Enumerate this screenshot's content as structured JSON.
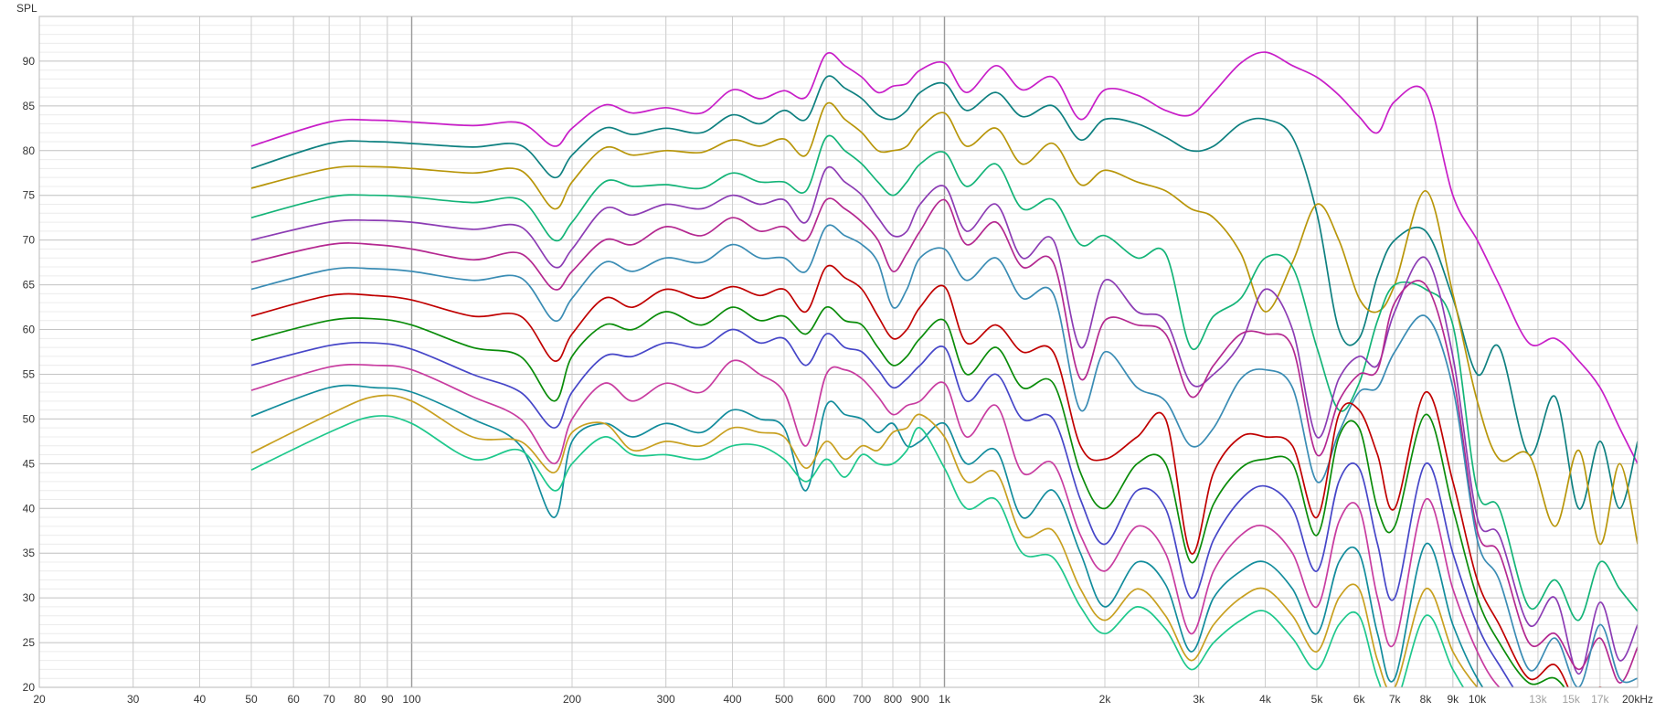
{
  "chart_data": {
    "type": "line",
    "ylabel": "SPL",
    "xscale": "log",
    "xlim": [
      20,
      20000
    ],
    "ylim": [
      20,
      95
    ],
    "grid": true,
    "x_tick_values": [
      20,
      30,
      40,
      50,
      60,
      70,
      80,
      90,
      100,
      200,
      300,
      400,
      500,
      600,
      700,
      800,
      900,
      1000,
      2000,
      3000,
      4000,
      5000,
      6000,
      7000,
      8000,
      9000,
      10000,
      13000,
      15000,
      17000,
      20000
    ],
    "x_tick_labels": [
      "20",
      "30",
      "40",
      "50",
      "60",
      "70",
      "80",
      "90",
      "100",
      "200",
      "300",
      "400",
      "500",
      "600",
      "700",
      "800",
      "900",
      "1k",
      "2k",
      "3k",
      "4k",
      "5k",
      "6k",
      "7k",
      "8k",
      "9k",
      "10k",
      "13k",
      "15k",
      "17k",
      "20kHz"
    ],
    "x_tick_faint": [
      false,
      false,
      false,
      false,
      false,
      false,
      false,
      false,
      false,
      false,
      false,
      false,
      false,
      false,
      false,
      false,
      false,
      false,
      false,
      false,
      false,
      false,
      false,
      false,
      false,
      false,
      false,
      true,
      true,
      true,
      false
    ],
    "y_tick_values": [
      20,
      25,
      30,
      35,
      40,
      45,
      50,
      55,
      60,
      65,
      70,
      75,
      80,
      85,
      90
    ],
    "y_tick_labels": [
      "20",
      "25",
      "30",
      "35",
      "40",
      "45",
      "50",
      "55",
      "60",
      "65",
      "70",
      "75",
      "80",
      "85",
      "90"
    ],
    "freqs": [
      50,
      70,
      85,
      100,
      130,
      160,
      185,
      200,
      230,
      260,
      300,
      350,
      400,
      450,
      500,
      550,
      600,
      650,
      700,
      750,
      800,
      850,
      900,
      1000,
      1100,
      1250,
      1400,
      1600,
      1800,
      2000,
      2300,
      2600,
      2900,
      3200,
      3600,
      4000,
      4500,
      5000,
      5500,
      6000,
      6500,
      7000,
      8000,
      9000,
      10000,
      11000,
      12500,
      14000,
      15500,
      17000,
      18500,
      20000
    ],
    "series": [
      {
        "color": "#c81ec8",
        "values": [
          80.5,
          83.2,
          83.4,
          83.2,
          82.8,
          83.1,
          80.5,
          82.5,
          85.1,
          84.2,
          84.8,
          84.2,
          86.8,
          85.8,
          86.7,
          86.0,
          90.8,
          89.5,
          88.2,
          86.5,
          87.2,
          87.5,
          89.0,
          89.8,
          86.5,
          89.5,
          86.8,
          88.2,
          83.5,
          86.8,
          86.2,
          84.5,
          84.0,
          86.5,
          89.8,
          91.0,
          89.5,
          88.2,
          86.2,
          83.8,
          82.0,
          85.5,
          86.5,
          75.0,
          70.0,
          65.0,
          58.5,
          59.0,
          56.5,
          53.5,
          49.0,
          45.0
        ]
      },
      {
        "color": "#0e8080",
        "values": [
          78.0,
          80.8,
          81.0,
          80.8,
          80.4,
          80.6,
          77.0,
          79.5,
          82.5,
          81.8,
          82.5,
          82.0,
          84.0,
          83.0,
          84.5,
          83.5,
          88.2,
          87.0,
          85.8,
          84.0,
          83.5,
          84.5,
          86.5,
          87.5,
          84.5,
          86.5,
          83.8,
          85.0,
          81.2,
          83.5,
          83.0,
          81.5,
          80.0,
          80.5,
          83.0,
          83.5,
          81.5,
          73.0,
          60.0,
          59.0,
          66.0,
          70.0,
          71.0,
          63.5,
          55.0,
          58.0,
          46.0,
          52.5,
          40.0,
          47.5,
          40.0,
          47.5
        ]
      },
      {
        "color": "#b8960a",
        "values": [
          75.8,
          78.0,
          78.2,
          78.0,
          77.5,
          77.8,
          73.5,
          76.5,
          80.3,
          79.5,
          80.0,
          79.8,
          81.2,
          80.5,
          81.3,
          79.5,
          85.2,
          83.5,
          82.0,
          80.0,
          80.0,
          80.5,
          82.5,
          84.2,
          80.5,
          82.5,
          78.5,
          80.8,
          76.2,
          77.8,
          76.5,
          75.5,
          73.5,
          72.5,
          68.5,
          62.0,
          67.5,
          74.0,
          70.0,
          63.5,
          62.0,
          65.0,
          75.5,
          64.0,
          52.0,
          45.5,
          46.0,
          38.0,
          46.5,
          36.0,
          45.0,
          36.0
        ]
      },
      {
        "color": "#14b478",
        "values": [
          72.5,
          74.8,
          75.0,
          74.8,
          74.2,
          74.5,
          70.0,
          72.0,
          76.5,
          76.0,
          76.2,
          75.8,
          77.5,
          76.5,
          76.5,
          75.5,
          81.5,
          80.0,
          78.5,
          76.5,
          75.0,
          76.5,
          78.5,
          79.8,
          76.0,
          78.5,
          73.5,
          74.5,
          69.5,
          70.5,
          68.0,
          68.5,
          58.0,
          61.5,
          63.5,
          68.0,
          67.0,
          58.0,
          51.0,
          54.0,
          61.0,
          65.0,
          64.5,
          60.5,
          42.0,
          40.0,
          29.0,
          32.0,
          27.5,
          34.0,
          31.0,
          28.5
        ]
      },
      {
        "color": "#8c3cb4",
        "values": [
          70.0,
          72.0,
          72.2,
          72.0,
          71.2,
          71.5,
          67.0,
          69.0,
          73.5,
          72.8,
          74.0,
          73.5,
          75.0,
          74.0,
          74.5,
          72.0,
          78.0,
          76.5,
          75.0,
          72.5,
          70.5,
          71.0,
          74.0,
          76.0,
          71.0,
          74.0,
          68.0,
          70.0,
          58.0,
          65.5,
          62.0,
          61.0,
          54.0,
          55.0,
          58.5,
          64.5,
          60.0,
          48.0,
          54.5,
          57.0,
          56.0,
          62.0,
          68.0,
          57.0,
          39.0,
          37.0,
          27.0,
          30.0,
          21.5,
          29.5,
          23.0,
          27.0
        ]
      },
      {
        "color": "#b42890",
        "values": [
          67.5,
          69.5,
          69.5,
          69.0,
          67.8,
          68.5,
          64.5,
          66.5,
          70.0,
          69.5,
          71.5,
          70.5,
          72.5,
          71.0,
          71.5,
          70.0,
          74.5,
          73.5,
          72.0,
          70.0,
          66.5,
          68.5,
          71.0,
          74.5,
          69.5,
          72.0,
          67.0,
          67.5,
          54.5,
          61.0,
          60.5,
          59.5,
          52.5,
          56.0,
          59.5,
          59.5,
          58.0,
          46.0,
          52.0,
          55.0,
          55.5,
          63.0,
          65.0,
          55.0,
          37.5,
          35.0,
          25.0,
          26.0,
          22.0,
          25.5,
          20.5,
          24.5
        ]
      },
      {
        "color": "#3a8cb4",
        "values": [
          64.5,
          66.7,
          66.8,
          66.5,
          65.5,
          65.8,
          61.0,
          63.5,
          67.5,
          66.5,
          68.0,
          67.5,
          69.5,
          68.0,
          68.0,
          66.5,
          71.5,
          70.5,
          69.5,
          67.5,
          62.5,
          64.5,
          68.0,
          69.0,
          65.5,
          68.0,
          63.5,
          64.0,
          51.0,
          57.5,
          53.5,
          52.0,
          47.0,
          49.0,
          54.5,
          55.5,
          53.5,
          43.0,
          48.5,
          53.0,
          53.5,
          57.5,
          61.5,
          53.5,
          36.5,
          32.0,
          22.0,
          25.5,
          20.0,
          27.0,
          21.0,
          21.0
        ]
      },
      {
        "color": "#c00000",
        "values": [
          61.5,
          63.8,
          63.8,
          63.3,
          61.5,
          61.5,
          56.5,
          59.5,
          63.5,
          62.5,
          64.5,
          63.5,
          64.8,
          63.8,
          64.5,
          62.0,
          67.0,
          65.8,
          64.5,
          61.5,
          59.0,
          60.0,
          62.5,
          64.8,
          58.5,
          60.5,
          57.5,
          57.5,
          47.0,
          45.5,
          48.0,
          50.0,
          35.0,
          44.0,
          48.0,
          48.0,
          47.0,
          39.0,
          50.5,
          51.0,
          46.0,
          40.0,
          53.0,
          43.0,
          32.0,
          27.0,
          21.0,
          22.5,
          18.0,
          20.0,
          18.0,
          18.0
        ]
      },
      {
        "color": "#0a8c0a",
        "values": [
          58.8,
          61.0,
          61.2,
          60.5,
          58.0,
          57.0,
          52.0,
          57.0,
          60.5,
          60.0,
          62.0,
          60.5,
          62.5,
          61.0,
          61.5,
          59.5,
          62.5,
          61.0,
          60.5,
          58.0,
          56.0,
          57.0,
          59.0,
          61.0,
          55.0,
          58.0,
          53.5,
          54.0,
          44.0,
          40.0,
          45.0,
          45.0,
          34.0,
          40.5,
          44.5,
          45.5,
          45.0,
          37.0,
          48.0,
          49.0,
          40.0,
          38.0,
          50.5,
          40.0,
          30.0,
          25.0,
          20.5,
          21.0,
          18.0,
          18.0,
          18.0,
          18.0
        ]
      },
      {
        "color": "#4646c8",
        "values": [
          56.0,
          58.2,
          58.5,
          57.8,
          55.0,
          53.0,
          49.0,
          53.0,
          57.0,
          57.0,
          58.5,
          58.0,
          60.0,
          58.5,
          59.0,
          56.0,
          59.5,
          58.0,
          57.5,
          55.5,
          53.5,
          54.5,
          56.0,
          58.0,
          52.0,
          55.0,
          50.0,
          50.0,
          41.0,
          36.0,
          42.0,
          40.0,
          30.0,
          36.5,
          41.0,
          42.5,
          40.0,
          33.0,
          43.0,
          44.5,
          36.0,
          30.0,
          45.0,
          35.0,
          27.0,
          22.5,
          18.0,
          19.5,
          18.0,
          18.0,
          18.0,
          18.0
        ]
      },
      {
        "color": "#c83ca0",
        "values": [
          53.2,
          55.8,
          56.0,
          55.5,
          52.5,
          50.0,
          45.0,
          50.0,
          54.0,
          52.0,
          54.0,
          53.0,
          56.5,
          55.0,
          53.0,
          47.0,
          55.0,
          55.5,
          54.5,
          52.5,
          50.5,
          51.5,
          52.0,
          54.0,
          48.0,
          51.5,
          44.0,
          45.0,
          37.0,
          33.0,
          38.0,
          35.0,
          26.0,
          33.0,
          37.0,
          38.0,
          35.0,
          29.0,
          38.5,
          40.0,
          30.0,
          25.0,
          41.0,
          31.0,
          24.0,
          20.0,
          18.0,
          18.0,
          18.0,
          18.0,
          18.0,
          18.0
        ]
      },
      {
        "color": "#128c9c",
        "values": [
          50.3,
          53.5,
          53.5,
          53.0,
          50.0,
          47.0,
          39.0,
          47.5,
          49.5,
          48.0,
          49.5,
          48.5,
          51.0,
          50.0,
          49.0,
          42.0,
          51.5,
          50.5,
          50.0,
          48.5,
          49.5,
          47.0,
          47.5,
          49.5,
          45.0,
          46.5,
          39.0,
          42.0,
          35.0,
          29.0,
          34.0,
          31.5,
          24.0,
          30.0,
          33.0,
          34.0,
          31.0,
          26.0,
          34.0,
          35.0,
          26.0,
          21.0,
          36.0,
          27.0,
          21.0,
          18.0,
          18.0,
          18.0,
          18.0,
          18.0,
          18.0,
          18.0
        ]
      },
      {
        "color": "#c8a020",
        "values": [
          46.2,
          50.5,
          52.5,
          52.0,
          48.0,
          47.5,
          44.0,
          48.5,
          49.5,
          46.5,
          47.5,
          47.0,
          49.0,
          48.5,
          48.0,
          44.5,
          47.5,
          45.5,
          47.0,
          46.5,
          48.5,
          49.0,
          50.5,
          48.0,
          43.0,
          44.0,
          37.0,
          37.5,
          31.0,
          27.5,
          31.0,
          28.0,
          23.0,
          27.0,
          30.0,
          31.0,
          28.0,
          24.0,
          30.0,
          31.0,
          23.0,
          20.0,
          31.0,
          24.0,
          20.0,
          18.0,
          18.0,
          18.0,
          18.0,
          18.0,
          18.0,
          18.0
        ]
      },
      {
        "color": "#1ec88c",
        "values": [
          44.3,
          48.5,
          50.3,
          49.5,
          45.5,
          46.5,
          42.0,
          45.0,
          48.0,
          46.0,
          46.0,
          45.5,
          47.0,
          47.0,
          45.5,
          43.0,
          45.5,
          43.5,
          46.0,
          45.0,
          45.0,
          46.5,
          49.0,
          44.5,
          40.0,
          41.0,
          35.0,
          34.5,
          29.0,
          26.0,
          29.0,
          26.5,
          22.0,
          25.0,
          27.5,
          28.5,
          25.5,
          22.0,
          27.0,
          28.0,
          21.0,
          18.0,
          28.0,
          22.0,
          18.0,
          18.0,
          18.0,
          18.0,
          18.0,
          18.0,
          18.0,
          18.0
        ]
      }
    ]
  }
}
